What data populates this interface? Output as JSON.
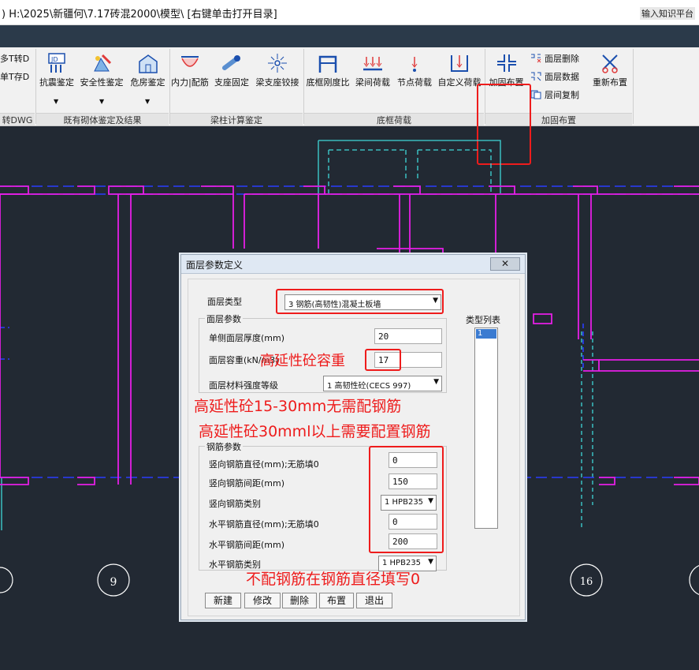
{
  "window": {
    "path": ") H:\\2025\\新疆何\\7.17砖混2000\\模型\\ [右键单击打开目录]",
    "search_hint": "输入知识平台"
  },
  "ribbon": {
    "left_partial": {
      "top": "多T转D",
      "bottom": "单T存D",
      "group": "转DWG"
    },
    "items": {
      "seismic": "抗震鉴定",
      "safety": "安全性鉴定",
      "danger": "危房鉴定",
      "internal": "内力|配筋",
      "support_fixed": "支座固定",
      "support_hinge": "梁支座铰接",
      "frame_ratio": "底框刚度比",
      "span_load": "梁间荷载",
      "node_load": "节点荷载",
      "custom_load": "自定义荷载",
      "reinforce": "加固布置",
      "layer_delete": "面层删除",
      "layer_data": "面层数据",
      "layer_copy": "层间复制",
      "re_layout": "重新布置"
    },
    "groups": {
      "existing": "既有砌体鉴定及结果",
      "beam_column": "梁柱计算鉴定",
      "frame_load": "底框荷载",
      "reinforce": "加固布置"
    }
  },
  "cad": {
    "axis_labels": [
      "9",
      "16"
    ]
  },
  "dialog": {
    "title": "面层参数定义",
    "close": "✕",
    "layer_type_label": "面层类型",
    "layer_type_value": "3 钢筋(高韧性)混凝土板墙",
    "layer_params_title": "面层参数",
    "thickness_label": "单侧面层厚度(mm)",
    "thickness_value": "20",
    "density_label": "面层容重(kN/m3)",
    "density_value": "17",
    "strength_label": "面层材料强度等级",
    "strength_value": "1 高韧性砼(CECS 997)",
    "rebar_title": "钢筋参数",
    "v_dia_label": "竖向钢筋直径(mm);无筋填0",
    "v_dia_value": "0",
    "v_spacing_label": "竖向钢筋间距(mm)",
    "v_spacing_value": "150",
    "v_type_label": "竖向钢筋类别",
    "v_type_value": "1 HPB235",
    "h_dia_label": "水平钢筋直径(mm);无筋填0",
    "h_dia_value": "0",
    "h_spacing_label": "水平钢筋间距(mm)",
    "h_spacing_value": "200",
    "h_type_label": "水平钢筋类别",
    "h_type_value": "1 HPB235",
    "type_list_title": "类型列表",
    "type_list_items": [
      "1"
    ],
    "buttons": {
      "new": "新建",
      "modify": "修改",
      "delete": "删除",
      "layout": "布置",
      "exit": "退出"
    }
  },
  "annotations": {
    "density_note": "高延性砼容重",
    "note_15_30": "高延性砼15-30mm无需配钢筋",
    "note_30_up": "高延性砼30mml以上需要配置钢筋",
    "note_zero": "不配钢筋在钢筋直径填写0"
  },
  "colors": {
    "cad_background": "#222933",
    "magenta": "#e61ee6",
    "blue": "#2a3cff",
    "cyan": "#3fd8d8",
    "highlight_red": "#ee1c1c"
  }
}
